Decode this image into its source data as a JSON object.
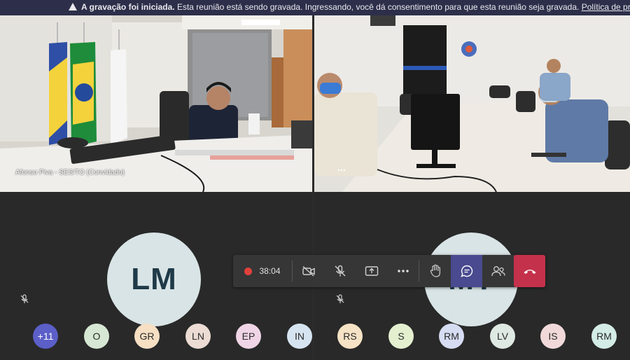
{
  "banner": {
    "title": "A gravação foi iniciada.",
    "message": "Esta reunião está sendo gravada. Ingressando, você dá consentimento para que esta reunião seja gravada.",
    "link": "Política de priv"
  },
  "tiles": {
    "left_video_name": "Afonso Piva - SES/TO (Convidado)",
    "left_avatar_initials": "LM",
    "right_avatar_initials": "MT"
  },
  "controls": {
    "recording_time": "38:04"
  },
  "participants": [
    {
      "initials": "+11",
      "color": "#5b5fc7",
      "text_color": "#ffffff"
    },
    {
      "initials": "O",
      "color": "#d6e8d3",
      "text_color": "#2a2a2a"
    },
    {
      "initials": "GR",
      "color": "#f6dfc3",
      "text_color": "#2a2a2a"
    },
    {
      "initials": "LN",
      "color": "#ecdcd3",
      "text_color": "#2a2a2a"
    },
    {
      "initials": "EP",
      "color": "#f0d5e6",
      "text_color": "#2a2a2a"
    },
    {
      "initials": "IN",
      "color": "#d6e4f2",
      "text_color": "#2a2a2a"
    },
    {
      "initials": "RS",
      "color": "#f6e3c5",
      "text_color": "#2a2a2a"
    },
    {
      "initials": "S",
      "color": "#e3efcf",
      "text_color": "#2a2a2a"
    },
    {
      "initials": "RM",
      "color": "#d6dcf2",
      "text_color": "#2a2a2a"
    },
    {
      "initials": "LV",
      "color": "#dfe9e3",
      "text_color": "#2a2a2a"
    },
    {
      "initials": "IS",
      "color": "#f2d9d9",
      "text_color": "#2a2a2a"
    },
    {
      "initials": "RM",
      "color": "#d3ece6",
      "text_color": "#2a2a2a"
    }
  ]
}
